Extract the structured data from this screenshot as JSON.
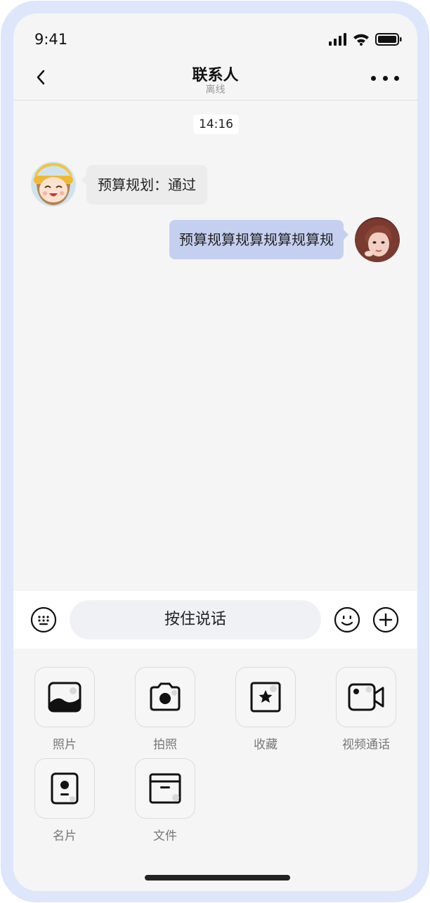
{
  "status_bar": {
    "time": "9:41"
  },
  "nav": {
    "title": "联系人",
    "subtitle": "离线"
  },
  "chat": {
    "timestamp": "14:16",
    "messages": [
      {
        "direction": "in",
        "text": "预算规划：通过"
      },
      {
        "direction": "out",
        "text": "预算规算规算规算规算规"
      }
    ]
  },
  "input_bar": {
    "hold_to_talk_label": "按住说话"
  },
  "panel": {
    "items": [
      {
        "label": "照片",
        "icon": "photo-icon"
      },
      {
        "label": "拍照",
        "icon": "camera-icon"
      },
      {
        "label": "收藏",
        "icon": "favorite-icon"
      },
      {
        "label": "视频通话",
        "icon": "video-call-icon"
      },
      {
        "label": "名片",
        "icon": "contact-card-icon"
      },
      {
        "label": "文件",
        "icon": "file-icon"
      }
    ]
  },
  "colors": {
    "frame": "#dde6fb",
    "background": "#f5f5f5",
    "outgoing_bubble": "#c5d0f0",
    "incoming_bubble": "#ececec"
  }
}
